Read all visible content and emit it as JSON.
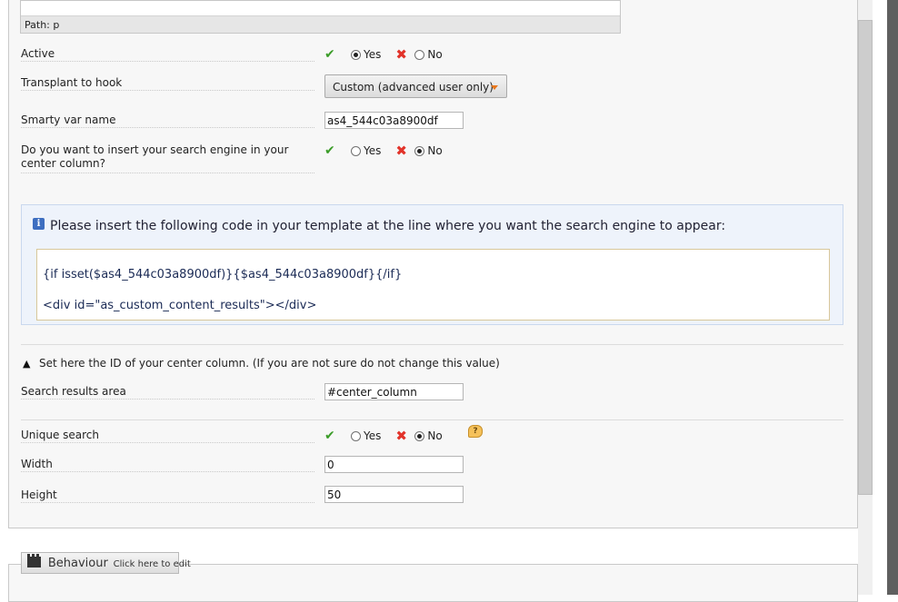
{
  "editor": {
    "path_label": "Path: p"
  },
  "fields": {
    "active": {
      "label": "Active",
      "yes": "Yes",
      "no": "No"
    },
    "hook": {
      "label": "Transplant to hook",
      "selected": "Custom (advanced user only)"
    },
    "smarty": {
      "label": "Smarty var name",
      "value": "as4_544c03a8900df"
    },
    "center": {
      "label": "Do you want to insert your search engine in your center column?",
      "yes": "Yes",
      "no": "No"
    },
    "results_area": {
      "label": "Search results area",
      "value": "#center_column"
    },
    "unique": {
      "label": "Unique search",
      "yes": "Yes",
      "no": "No"
    },
    "width": {
      "label": "Width",
      "value": "0"
    },
    "height": {
      "label": "Height",
      "value": "50"
    }
  },
  "info": {
    "text": "Please insert the following code in your template at the line where you want the search engine to appear:",
    "code_line1": "{if isset($as4_544c03a8900df)}{$as4_544c03a8900df}{/if}",
    "code_line2": "<div id=\"as_custom_content_results\"></div>"
  },
  "warning": {
    "text": "Set here the ID of your center column. (If you are not sure do not change this value)"
  },
  "behaviour": {
    "label": "Behaviour",
    "hint": "Click here to edit"
  },
  "icons": {
    "ok": "check-icon",
    "ko": "cross-icon",
    "info": "info-icon",
    "warning": "warning-icon",
    "help": "help-bubble-icon",
    "behaviour": "clapperboard-icon"
  },
  "colors": {
    "ok": "#3b9c28",
    "ko": "#e2332a",
    "info_bg": "#eef3fb",
    "code_border": "#d8c79a"
  }
}
